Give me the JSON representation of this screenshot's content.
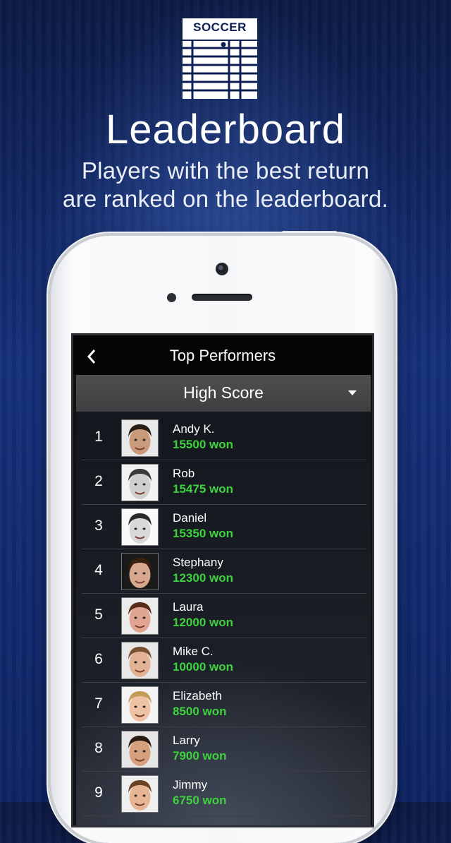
{
  "header": {
    "logo_text": "SOCCER",
    "title": "Leaderboard",
    "subtitle_line1": "Players with the best return",
    "subtitle_line2": "are ranked on the leaderboard."
  },
  "app": {
    "nav_title": "Top Performers",
    "back_icon": "chevron-left-icon",
    "dropdown_label": "High Score",
    "dropdown_icon": "caret-down-icon"
  },
  "colors": {
    "score_green": "#3fd23f",
    "background_blue": "#15307a"
  },
  "leaderboard": [
    {
      "rank": "1",
      "name": "Andy K.",
      "score": "15500 won",
      "skin": "#c99b7b",
      "hair": "#2a1d14",
      "bg": "#e8e8e8"
    },
    {
      "rank": "2",
      "name": "Rob",
      "score": "15475 won",
      "skin": "#cfcfcf",
      "hair": "#3a3a3a",
      "bg": "#f2f2f2"
    },
    {
      "rank": "3",
      "name": "Daniel",
      "score": "15350 won",
      "skin": "#d8d8d8",
      "hair": "#2b2b2b",
      "bg": "#fafafa"
    },
    {
      "rank": "4",
      "name": "Stephany",
      "score": "12300 won",
      "skin": "#d8a88e",
      "hair": "#3b1e12",
      "bg": "#1a1a1a"
    },
    {
      "rank": "5",
      "name": "Laura",
      "score": "12000 won",
      "skin": "#e0a592",
      "hair": "#5a2b1a",
      "bg": "#ececec"
    },
    {
      "rank": "6",
      "name": "Mike C.",
      "score": "10000 won",
      "skin": "#e3b295",
      "hair": "#7a5233",
      "bg": "#e8e8e8"
    },
    {
      "rank": "7",
      "name": "Elizabeth",
      "score": "8500 won",
      "skin": "#eec3a5",
      "hair": "#c69a58",
      "bg": "#f4f4f4"
    },
    {
      "rank": "8",
      "name": "Larry",
      "score": "7900 won",
      "skin": "#d7a07c",
      "hair": "#2a1a10",
      "bg": "#e6e6e6"
    },
    {
      "rank": "9",
      "name": "Jimmy",
      "score": "6750 won",
      "skin": "#e6b593",
      "hair": "#6a4225",
      "bg": "#efefef"
    }
  ]
}
